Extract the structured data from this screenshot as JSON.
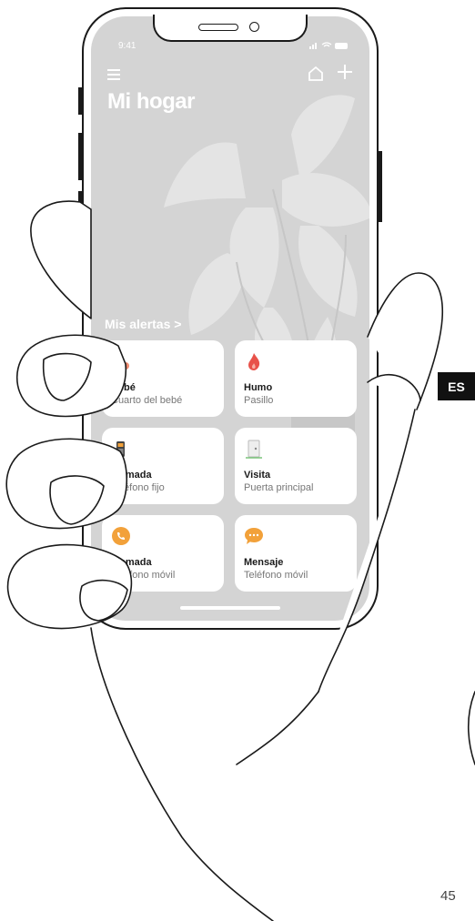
{
  "status_bar": {
    "time": "9:41"
  },
  "header": {
    "title": "Mi hogar"
  },
  "alerts_label": "Mis alertas >",
  "cards": [
    {
      "name": "Bebé",
      "location": "Cuarto del bebé",
      "icon": "baby-pacifier-icon"
    },
    {
      "name": "Humo",
      "location": "Pasillo",
      "icon": "flame-icon"
    },
    {
      "name": "Llamada",
      "location": "Teléfono fijo",
      "icon": "landline-phone-icon"
    },
    {
      "name": "Visita",
      "location": "Puerta principal",
      "icon": "doorbell-icon"
    },
    {
      "name": "Llamada",
      "location": "Teléfono móvil",
      "icon": "phone-call-icon"
    },
    {
      "name": "Mensaje",
      "location": "Teléfono móvil",
      "icon": "message-bubble-icon"
    }
  ],
  "language_tab": "ES",
  "page_number": "45",
  "colors": {
    "screen_bg": "#d4d4d4",
    "flame": "#e8524a",
    "phone_orange": "#f2a13a",
    "accent_green": "#7ac47a"
  }
}
